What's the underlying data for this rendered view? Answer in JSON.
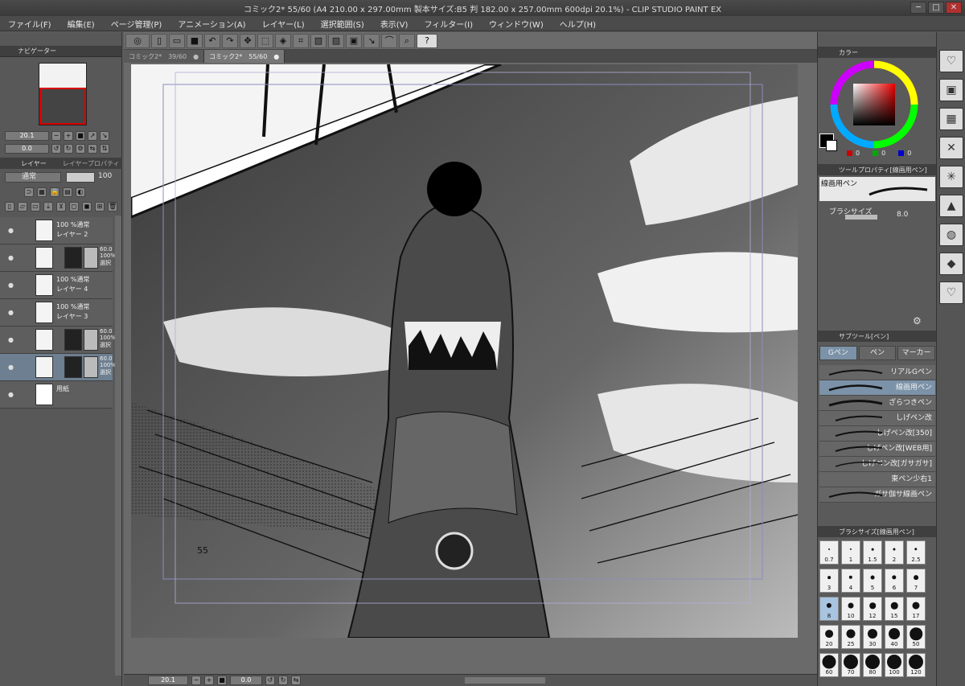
{
  "window": {
    "title": "コミック2* 55/60 (A4 210.00 x 297.00mm 製本サイズ:B5 判 182.00 x 257.00mm 600dpi 20.1%) - CLIP STUDIO PAINT EX",
    "min": "─",
    "max": "□",
    "close": "✕"
  },
  "menu": [
    "ファイル(F)",
    "編集(E)",
    "ページ管理(P)",
    "アニメーション(A)",
    "レイヤー(L)",
    "選択範囲(S)",
    "表示(V)",
    "フィルター(I)",
    "ウィンドウ(W)",
    "ヘルプ(H)"
  ],
  "toolbar": {
    "help": "?"
  },
  "navigator": {
    "title": "ナビゲーター",
    "zoom": "20.1",
    "angle": "0.0"
  },
  "layers": {
    "title": "レイヤー",
    "props_tab": "レイヤープロパティ",
    "blend": "通常",
    "opacity": "100",
    "items": [
      {
        "line1": "100 %通常",
        "line2": "レイヤー 2",
        "kind": "plain"
      },
      {
        "line1": "60.0",
        "line2": "100%選択",
        "kind": "mask"
      },
      {
        "line1": "100 %通常",
        "line2": "レイヤー 4",
        "kind": "plain"
      },
      {
        "line1": "100 %通常",
        "line2": "レイヤー 3",
        "kind": "plain"
      },
      {
        "line1": "60.0",
        "line2": "100%選択",
        "kind": "mask"
      },
      {
        "line1": "60.0",
        "line2": "100%選択",
        "kind": "mask"
      },
      {
        "line1": "",
        "line2": "用紙",
        "kind": "paper"
      }
    ]
  },
  "tabs": [
    {
      "label": "コミック2*",
      "page": "39/60"
    },
    {
      "label": "コミック2*",
      "page": "55/60"
    }
  ],
  "canvas": {
    "page_number": "55"
  },
  "statusbar": {
    "zoom": "20.1",
    "angle": "0.0"
  },
  "color": {
    "title": "カラー",
    "r": "0",
    "g": "0",
    "b": "0"
  },
  "toolprop": {
    "title": "ツールプロパティ[線画用ペン]",
    "tool": "線画用ペン",
    "size_label": "ブラシサイズ",
    "size_value": "8.0"
  },
  "subtool": {
    "title": "サブツール[ペン]",
    "tabs": [
      "Gペン",
      "ペン",
      "マーカー"
    ],
    "items": [
      "リアルGペン",
      "線画用ペン",
      "ざらつきペン",
      "しげペン改",
      "しげペン改[350]",
      "しげペン改[WEB用]",
      "しげペン改[ガサガサ]",
      "東ペン少右1",
      "ガサ伽サ線画ペン"
    ]
  },
  "brushsize": {
    "title": "ブラシサイズ[線画用ペン]",
    "values": [
      "0.7",
      "1",
      "1.5",
      "2",
      "2.5",
      "3",
      "4",
      "5",
      "6",
      "7",
      "8",
      "10",
      "12",
      "15",
      "17",
      "20",
      "25",
      "30",
      "40",
      "50",
      "60",
      "70",
      "80",
      "100",
      "120"
    ]
  }
}
